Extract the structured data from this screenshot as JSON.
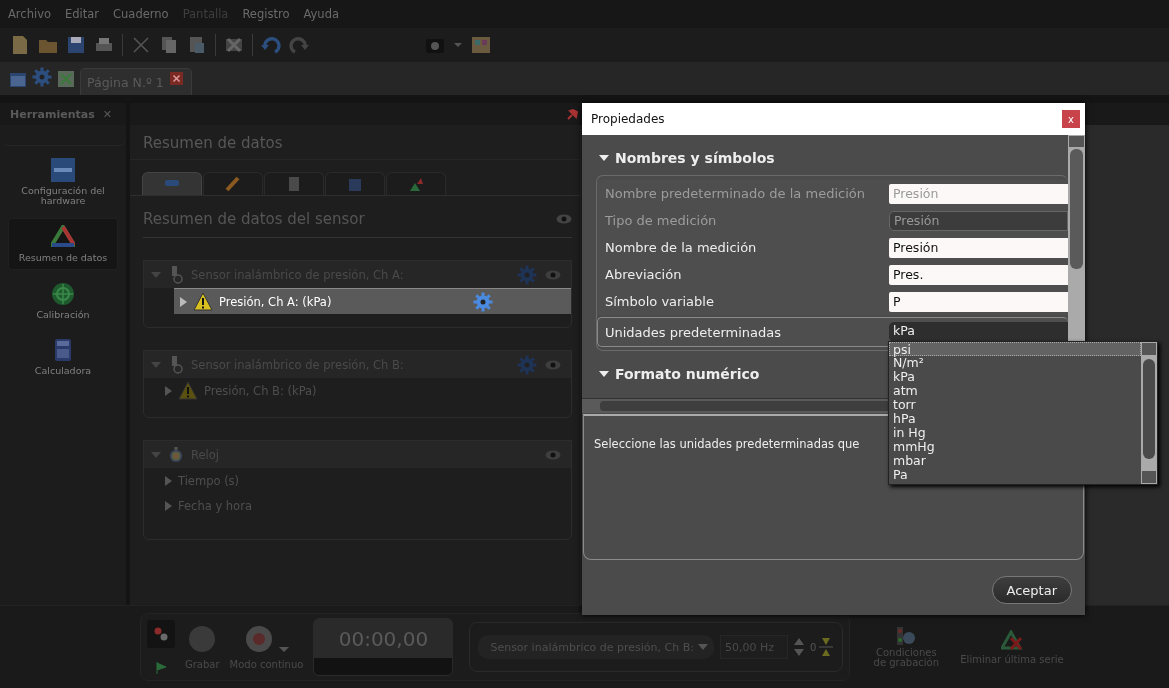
{
  "menu": [
    {
      "label": "Archivo",
      "disabled": false
    },
    {
      "label": "Editar",
      "disabled": false
    },
    {
      "label": "Cuaderno",
      "disabled": false
    },
    {
      "label": "Pantalla",
      "disabled": true
    },
    {
      "label": "Registro",
      "disabled": false
    },
    {
      "label": "Ayuda",
      "disabled": false
    }
  ],
  "document_tab": {
    "label": "Página N.º 1"
  },
  "tools_panel": {
    "title": "Herramientas",
    "close": "✕",
    "items": [
      {
        "label": "Configuración del hardware",
        "selected": false
      },
      {
        "label": "Resumen de datos",
        "selected": true
      },
      {
        "label": "Calibración",
        "selected": false
      },
      {
        "label": "Calculadora",
        "selected": false
      }
    ]
  },
  "data_summary": {
    "title": "Resumen de datos",
    "view_tabs": [
      {
        "selected": true
      },
      {
        "selected": false
      },
      {
        "selected": false
      },
      {
        "selected": false
      },
      {
        "selected": false
      }
    ],
    "subtitle": "Resumen de datos del sensor",
    "groups": [
      {
        "kind": "sensor",
        "title": "Sensor inalámbrico de presión, Ch A:",
        "children": [
          {
            "label": "Presión, Ch A: (kPa)",
            "selected": true,
            "warning": true
          }
        ]
      },
      {
        "kind": "sensor",
        "title": "Sensor inalámbrico de presión, Ch B:",
        "children": [
          {
            "label": "Presión, Ch B: (kPa)",
            "selected": false,
            "warning": true
          }
        ]
      },
      {
        "kind": "clock",
        "title": "Reloj",
        "children": [
          {
            "label": "Tiempo (s)",
            "selected": false,
            "warning": false
          },
          {
            "label": "Fecha y hora",
            "selected": false,
            "warning": false
          }
        ]
      }
    ]
  },
  "dialog": {
    "title": "Propiedades",
    "close": "x",
    "sections": [
      {
        "title": "Nombres y símbolos",
        "expanded": true,
        "rows": [
          {
            "kind": "text",
            "label": "Nombre predeterminado de la medición",
            "value": "Presión",
            "disabled": true,
            "focused": false
          },
          {
            "kind": "select",
            "label": "Tipo de medición",
            "value": "Presión",
            "disabled": true,
            "focused": false
          },
          {
            "kind": "text",
            "label": "Nombre de la medición",
            "value": "Presión",
            "disabled": false,
            "focused": false
          },
          {
            "kind": "text",
            "label": "Abreviación",
            "value": "Pres.",
            "disabled": false,
            "focused": false
          },
          {
            "kind": "text",
            "label": "Símbolo variable",
            "value": "P",
            "disabled": false,
            "focused": false
          },
          {
            "kind": "select",
            "label": "Unidades predeterminadas",
            "value": "kPa",
            "disabled": false,
            "focused": true
          }
        ]
      },
      {
        "title": "Formato numérico",
        "expanded": true
      }
    ],
    "help_text": "Seleccione las unidades predeterminadas que",
    "button": "Aceptar"
  },
  "units_dropdown": {
    "options": [
      {
        "label": "psi",
        "selected": true
      },
      {
        "label": "N/m²",
        "selected": false
      },
      {
        "label": "kPa",
        "selected": false
      },
      {
        "label": "atm",
        "selected": false
      },
      {
        "label": "torr",
        "selected": false
      },
      {
        "label": "hPa",
        "selected": false
      },
      {
        "label": "in Hg",
        "selected": false
      },
      {
        "label": "mmHg",
        "selected": false
      },
      {
        "label": "mbar",
        "selected": false
      },
      {
        "label": "Pa",
        "selected": false
      }
    ]
  },
  "record_bar": {
    "record_label": "Grabar",
    "mode_label": "Modo continuo",
    "time": "00:00,00",
    "sensor": "Sensor inalámbrico de presión, Ch B:",
    "rate": "50,00 Hz",
    "zero": "0",
    "conditions_label": "Condiciones de grabación",
    "delete_label": "Eliminar última serie"
  }
}
